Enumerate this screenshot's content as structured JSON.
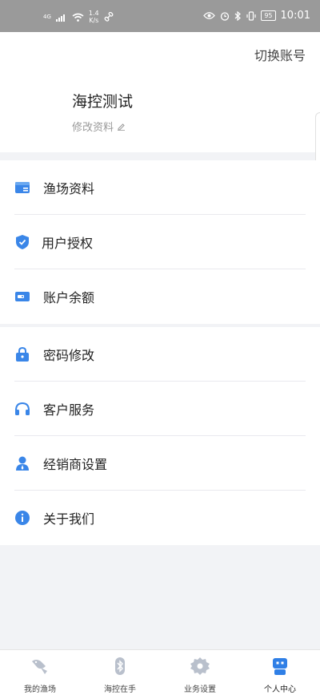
{
  "status_bar": {
    "network": "4G",
    "speed_value": "1.4",
    "speed_unit": "K/s",
    "battery": "95",
    "time": "10:01"
  },
  "header": {
    "switch_account": "切换账号",
    "profile_name": "海控测试",
    "edit_profile": "修改资料"
  },
  "menu_group_1": [
    {
      "label": "渔场资料",
      "icon": "folder-icon"
    },
    {
      "label": "用户授权",
      "icon": "shield-check-icon"
    },
    {
      "label": "账户余额",
      "icon": "wallet-icon"
    }
  ],
  "menu_group_2": [
    {
      "label": "密码修改",
      "icon": "lock-icon"
    },
    {
      "label": "客户服务",
      "icon": "headset-icon"
    },
    {
      "label": "经销商设置",
      "icon": "person-icon"
    },
    {
      "label": "关于我们",
      "icon": "info-icon"
    }
  ],
  "tabbar": [
    {
      "label": "我的渔场",
      "icon": "fish-icon"
    },
    {
      "label": "海控在手",
      "icon": "bluetooth-icon"
    },
    {
      "label": "业务设置",
      "icon": "gear-icon"
    },
    {
      "label": "个人中心",
      "icon": "robot-icon"
    }
  ],
  "colors": {
    "accent": "#3a86e8",
    "inactive_icon": "#b9c0cc",
    "active_icon": "#2f7fe6",
    "status_bar_bg": "#9a9a9a"
  }
}
